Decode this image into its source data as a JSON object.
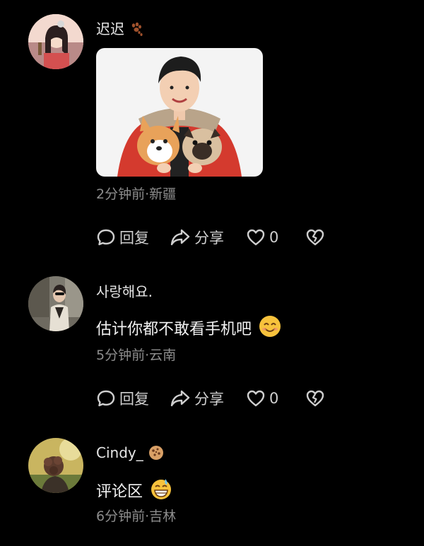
{
  "comments": [
    {
      "username": "迟迟",
      "username_emoji": "paw-prints-icon",
      "text": "",
      "has_image": true,
      "meta": "2分钟前·新疆",
      "reply_label": "回复",
      "share_label": "分享",
      "like_count": "0"
    },
    {
      "username": "사랑해요.",
      "text": "估计你都不敢看手机吧",
      "text_emoji": "smiling-face-icon",
      "meta": "5分钟前·云南",
      "reply_label": "回复",
      "share_label": "分享",
      "like_count": "0"
    },
    {
      "username": "Cindy_",
      "username_emoji": "cookie-icon",
      "text": "评论区",
      "text_emoji": "grinning-sweat-face-icon",
      "meta": "6分钟前·吉林"
    }
  ],
  "colors": {
    "background": "#000000",
    "text_primary": "#f2f2f2",
    "text_meta": "#8d8d8d",
    "action": "#cfcfcf"
  }
}
